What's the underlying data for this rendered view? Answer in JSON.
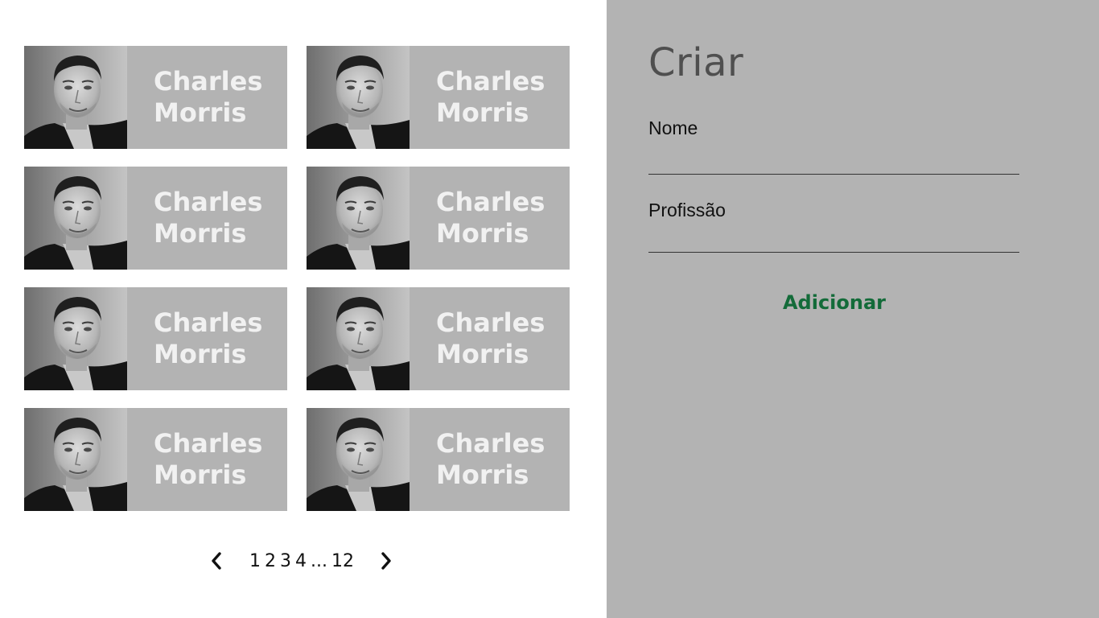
{
  "cards": [
    {
      "first_name": "Charles",
      "last_name": "Morris"
    },
    {
      "first_name": "Charles",
      "last_name": "Morris"
    },
    {
      "first_name": "Charles",
      "last_name": "Morris"
    },
    {
      "first_name": "Charles",
      "last_name": "Morris"
    },
    {
      "first_name": "Charles",
      "last_name": "Morris"
    },
    {
      "first_name": "Charles",
      "last_name": "Morris"
    },
    {
      "first_name": "Charles",
      "last_name": "Morris"
    },
    {
      "first_name": "Charles",
      "last_name": "Morris"
    }
  ],
  "pagination": {
    "pages": [
      "1",
      "2",
      "3",
      "4"
    ],
    "ellipsis": "...",
    "last_page": "12",
    "prev_icon": "chevron-left-icon",
    "next_icon": "chevron-right-icon"
  },
  "form": {
    "title": "Criar",
    "name_label": "Nome",
    "name_value": "",
    "profession_label": "Profissão",
    "profession_value": "",
    "submit_label": "Adicionar"
  },
  "colors": {
    "card_background": "#b3b3b3",
    "card_text": "#f1f1f1",
    "panel_background": "#b3b3b3",
    "accent_green": "#136b39"
  }
}
